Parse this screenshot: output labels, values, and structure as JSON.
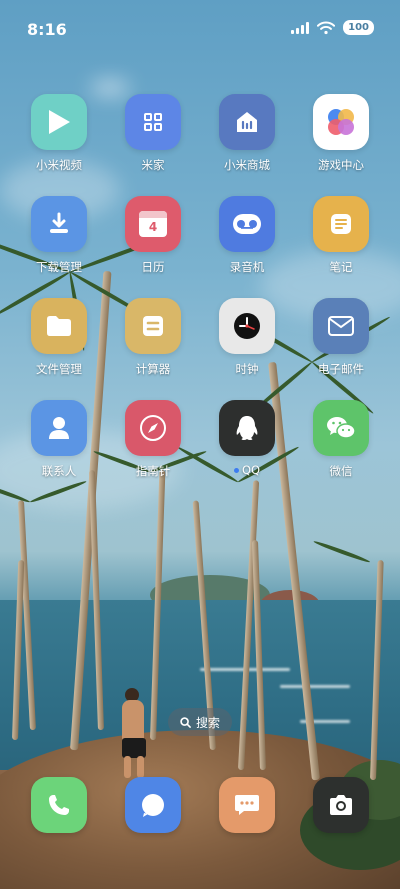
{
  "status_bar": {
    "time": "8:16",
    "battery": "100"
  },
  "apps": [
    {
      "label": "小米视频",
      "icon": "play-icon",
      "color": "#6fd0c6"
    },
    {
      "label": "米家",
      "icon": "grid-icon",
      "color": "#5d86e6"
    },
    {
      "label": "小米商城",
      "icon": "mi-store-icon",
      "color": "#5879c0"
    },
    {
      "label": "游戏中心",
      "icon": "game-dots-icon",
      "color": "#ffffff"
    },
    {
      "label": "下载管理",
      "icon": "download-icon",
      "color": "#5b95e4"
    },
    {
      "label": "日历",
      "icon": "calendar-icon",
      "color": "#de5b6c",
      "calendar_day": "4"
    },
    {
      "label": "录音机",
      "icon": "recorder-icon",
      "color": "#4f7be0"
    },
    {
      "label": "笔记",
      "icon": "notes-icon",
      "color": "#e6b24c"
    },
    {
      "label": "文件管理",
      "icon": "folder-icon",
      "color": "#d9b35e"
    },
    {
      "label": "计算器",
      "icon": "calculator-icon",
      "color": "#d9b768"
    },
    {
      "label": "时钟",
      "icon": "clock-icon",
      "color": "#e8e8e8"
    },
    {
      "label": "电子邮件",
      "icon": "mail-icon",
      "color": "#5a80b8"
    },
    {
      "label": "联系人",
      "icon": "contact-icon",
      "color": "#5b95e4"
    },
    {
      "label": "指南针",
      "icon": "compass-icon",
      "color": "#d9586a"
    },
    {
      "label": "QQ",
      "icon": "qq-penguin-icon",
      "color": "#2d2f2e",
      "has_dot": true
    },
    {
      "label": "微信",
      "icon": "wechat-icon",
      "color": "#5ec46a"
    }
  ],
  "search": {
    "label": "搜索",
    "icon": "search-icon"
  },
  "dock": [
    {
      "name": "phone",
      "icon": "phone-icon",
      "color": "#6cd47a"
    },
    {
      "name": "browser",
      "icon": "browser-bubble-icon",
      "color": "#4f86e6"
    },
    {
      "name": "messages",
      "icon": "message-icon",
      "color": "#e49a6a"
    },
    {
      "name": "camera",
      "icon": "camera-icon",
      "color": "#2d302e"
    }
  ]
}
